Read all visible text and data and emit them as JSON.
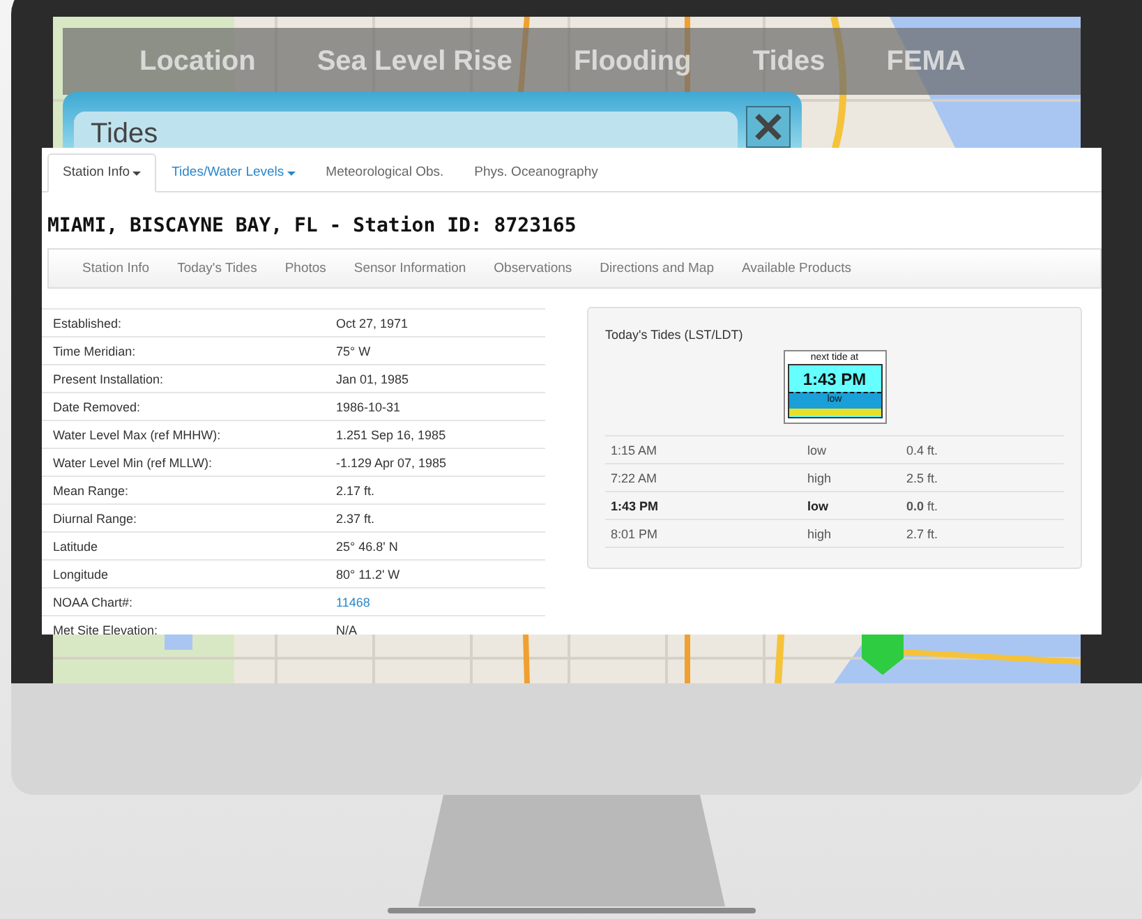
{
  "nav": [
    "Location",
    "Sea Level Rise",
    "Flooding",
    "Tides",
    "FEMA"
  ],
  "popup": {
    "title": "Tides"
  },
  "tabs": [
    {
      "label": "Station Info",
      "kind": "dropdown",
      "selected": true
    },
    {
      "label": "Tides/Water Levels",
      "kind": "dropdown",
      "selected": false
    },
    {
      "label": "Meteorological Obs.",
      "kind": "plain",
      "selected": false
    },
    {
      "label": "Phys. Oceanography",
      "kind": "plain",
      "selected": false
    }
  ],
  "station_title": "MIAMI, BISCAYNE BAY, FL - Station ID: 8723165",
  "subnav": [
    "Station Info",
    "Today's Tides",
    "Photos",
    "Sensor Information",
    "Observations",
    "Directions and Map",
    "Available Products"
  ],
  "station_info": [
    {
      "label": "Established:",
      "value": "Oct 27, 1971",
      "kind": "text"
    },
    {
      "label": "Time Meridian:",
      "value": "75° W",
      "kind": "text"
    },
    {
      "label": "Present Installation:",
      "value": "Jan 01, 1985",
      "kind": "text"
    },
    {
      "label": "Date Removed:",
      "value": "1986-10-31",
      "kind": "text"
    },
    {
      "label": "Water Level Max (ref MHHW):",
      "value": "1.251 Sep 16, 1985",
      "kind": "text"
    },
    {
      "label": "Water Level Min (ref MLLW):",
      "value": "-1.129 Apr 07, 1985",
      "kind": "text"
    },
    {
      "label": "Mean Range:",
      "value": "2.17 ft.",
      "kind": "text"
    },
    {
      "label": "Diurnal Range:",
      "value": "2.37 ft.",
      "kind": "text"
    },
    {
      "label": "Latitude",
      "value": "25° 46.8' N",
      "kind": "text"
    },
    {
      "label": "Longitude",
      "value": "80° 11.2' W",
      "kind": "text"
    },
    {
      "label": "NOAA Chart#:",
      "value": "11468",
      "kind": "link"
    },
    {
      "label": "Met Site Elevation:",
      "value": "N/A",
      "kind": "text"
    }
  ],
  "todays_tides": {
    "title": "Today's Tides (LST/LDT)",
    "widget": {
      "caption": "next tide at",
      "time": "1:43 PM",
      "state": "low"
    },
    "rows": [
      {
        "time": "1:15 AM",
        "type": "low",
        "height": "0.4 ft.",
        "next": false
      },
      {
        "time": "7:22 AM",
        "type": "high",
        "height": "2.5 ft.",
        "next": false
      },
      {
        "time": "1:43 PM",
        "type": "low",
        "height": "**0.0** ft.",
        "next": true
      },
      {
        "time": "8:01 PM",
        "type": "high",
        "height": "2.7 ft.",
        "next": false
      }
    ]
  }
}
